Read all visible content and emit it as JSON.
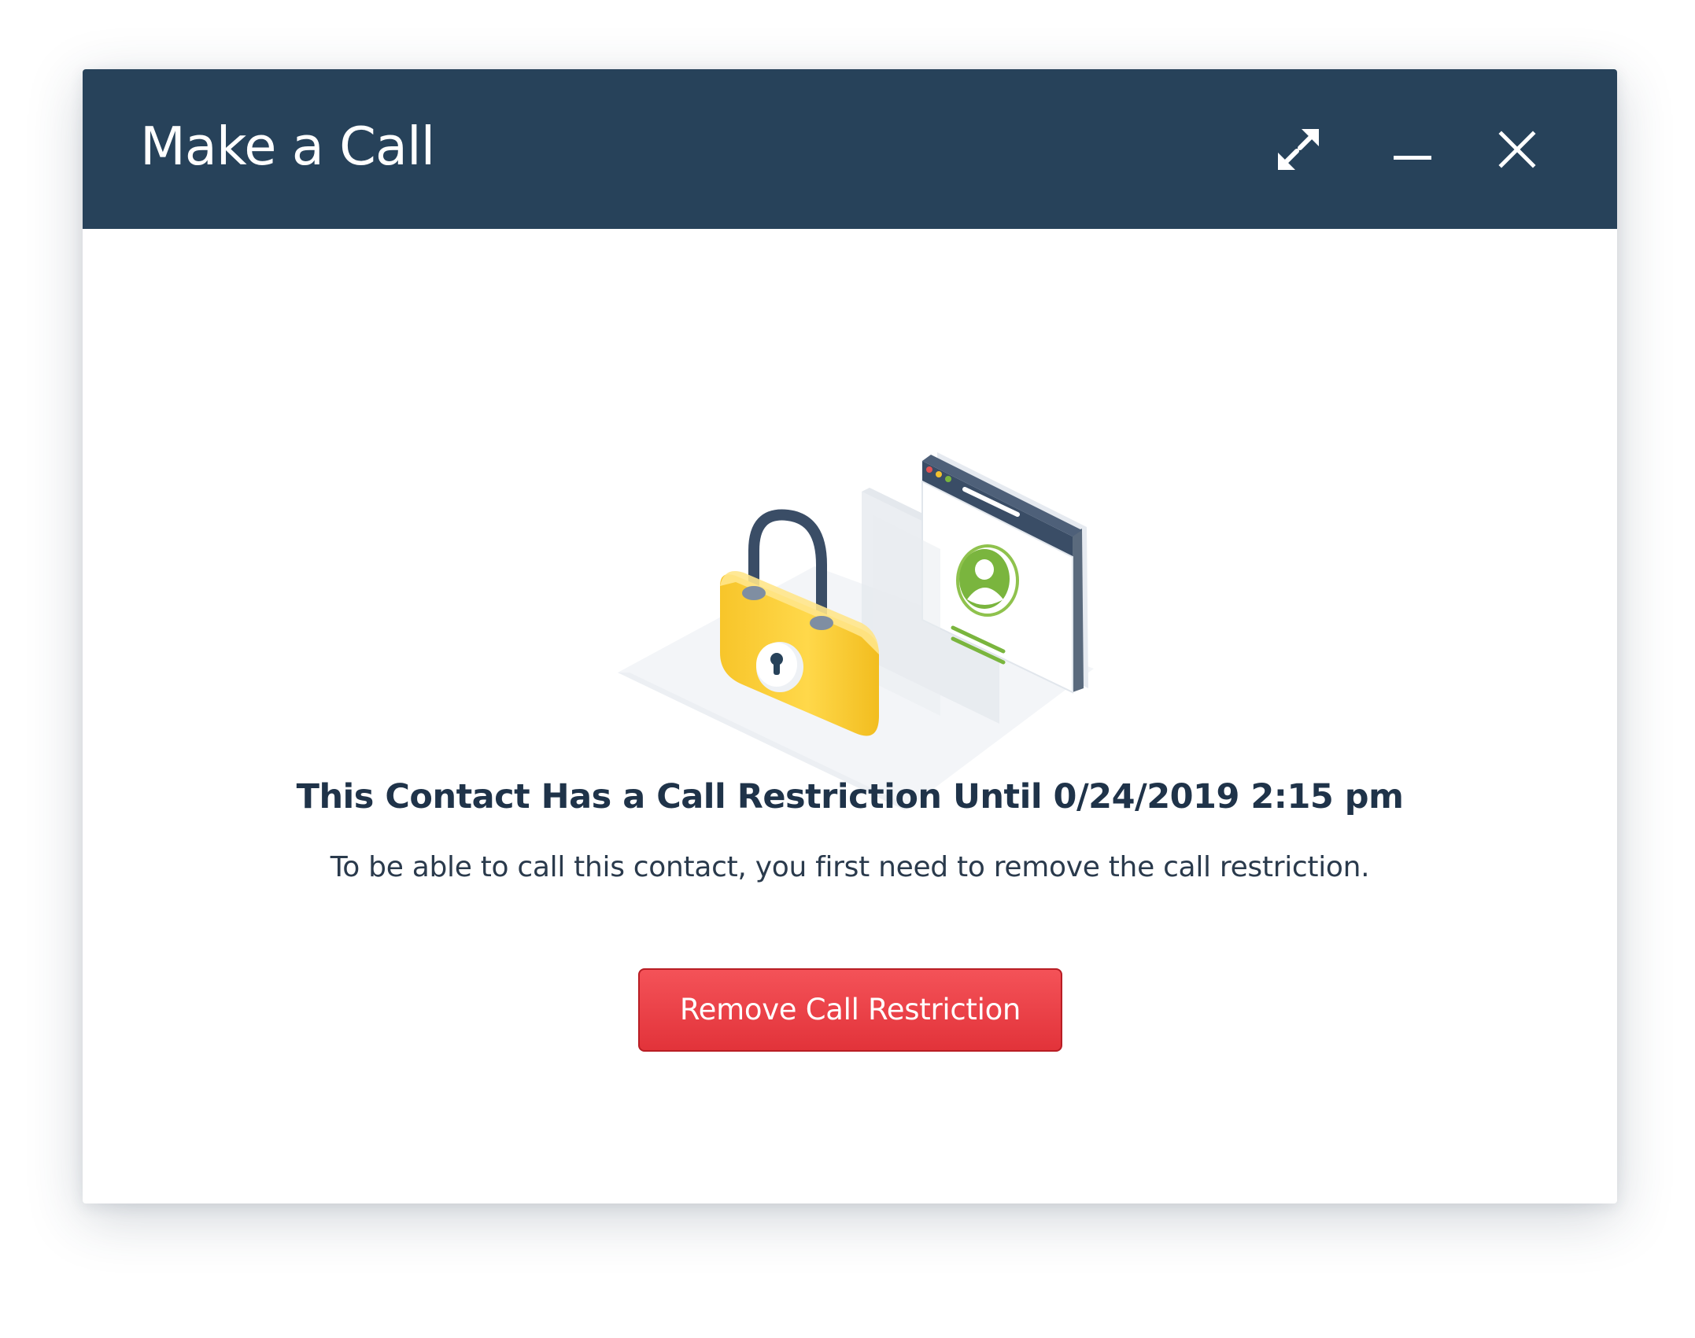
{
  "dialog": {
    "title": "Make a Call",
    "controls": {
      "expand": "expand-icon",
      "minimize": "minimize-icon",
      "close": "close-icon"
    }
  },
  "content": {
    "illustration": "padlock-and-contact-card",
    "heading": "This Contact Has a Call Restriction Until 0/24/2019 2:15 pm",
    "description": "To be able to call this contact, you first need to remove the call restriction.",
    "action_label": "Remove Call Restriction"
  },
  "colors": {
    "titlebar": "#27425a",
    "primary_button": "#e83a40",
    "heading_text": "#1f3349",
    "lock_body": "#fdd33b",
    "avatar_green": "#7ab53e"
  }
}
